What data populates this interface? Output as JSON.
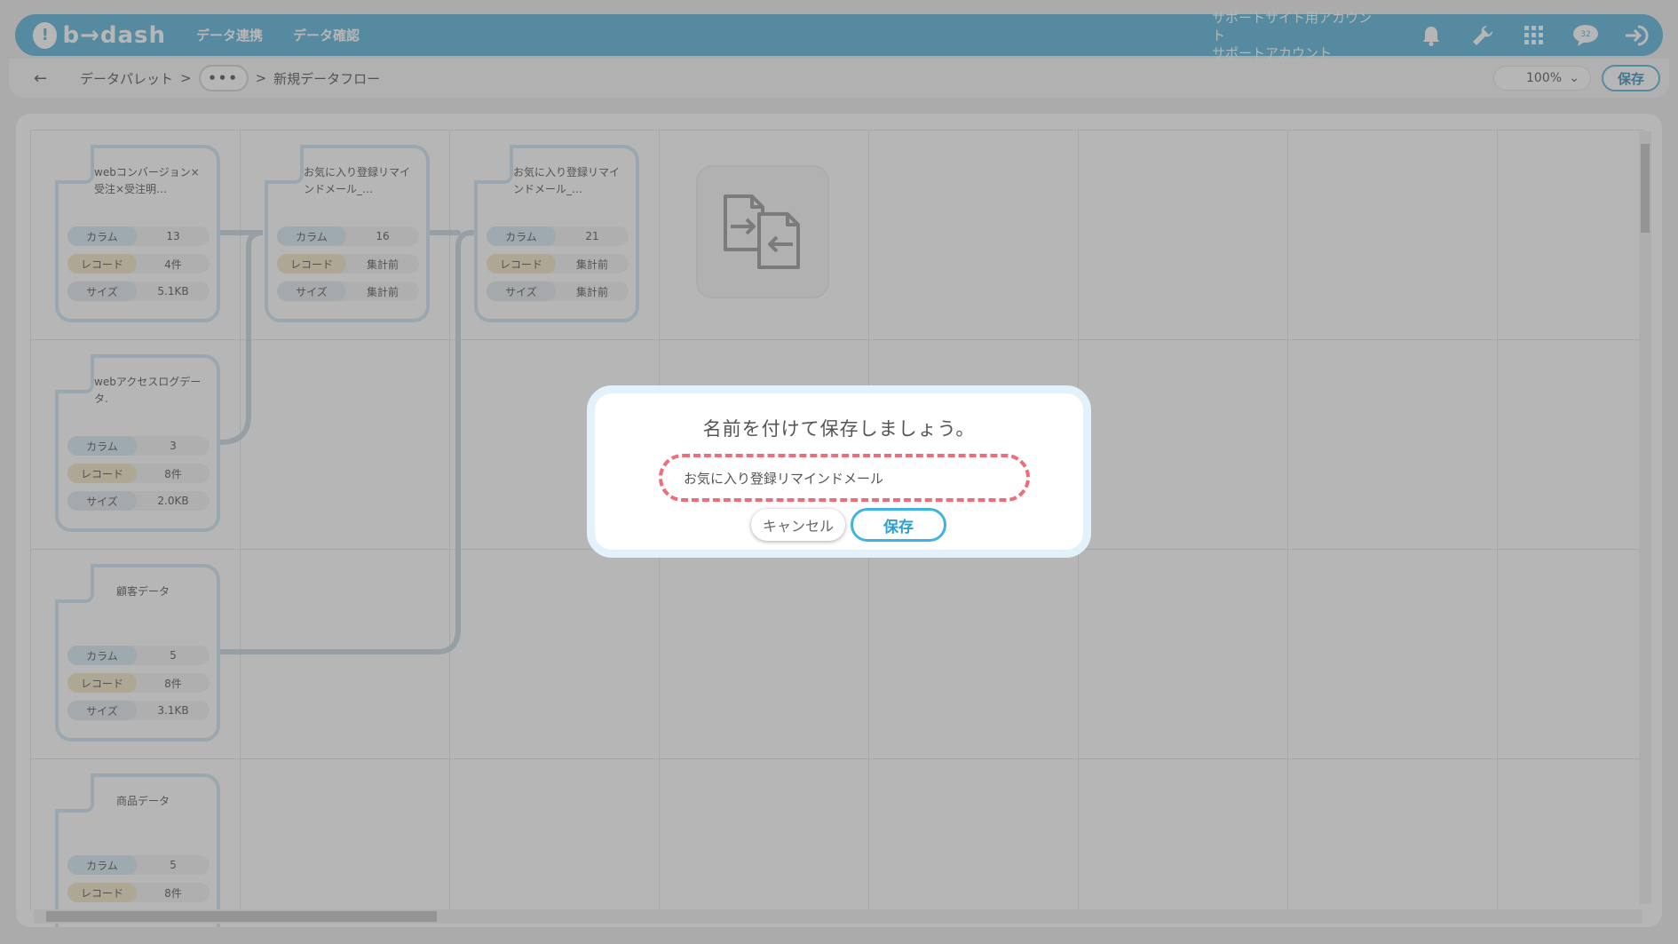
{
  "header": {
    "logo_text": "b→dash",
    "nav": [
      "データ連携",
      "データ確認"
    ],
    "account_line1": "サポートサイト用アカウント",
    "account_line2": "サポートアカウント",
    "icons": [
      "bell-icon",
      "wrench-icon",
      "grid-icon",
      "chat-icon",
      "logout-icon"
    ],
    "chat_badge": "32"
  },
  "breadcrumb": {
    "back": "←",
    "root": "データパレット",
    "separator": ">",
    "more": "•••",
    "current": "新規データフロー",
    "zoom": "100%",
    "save_label": "保存"
  },
  "nodes": [
    {
      "title": "webコンバージョン×受注×受注明…",
      "columns": "13",
      "records": "4件",
      "size": "5.1KB"
    },
    {
      "title": "お気に入り登録リマインドメール_…",
      "columns": "16",
      "records": "集計前",
      "size": "集計前"
    },
    {
      "title": "お気に入り登録リマインドメール_…",
      "columns": "21",
      "records": "集計前",
      "size": "集計前"
    },
    {
      "title": "webアクセスログデータ.",
      "columns": "3",
      "records": "8件",
      "size": "2.0KB"
    },
    {
      "title": "顧客データ",
      "columns": "5",
      "records": "8件",
      "size": "3.1KB"
    },
    {
      "title": "商品データ",
      "columns": "5",
      "records": "8件",
      "size": ""
    }
  ],
  "labels": {
    "columns": "カラム",
    "records": "レコード",
    "size": "サイズ"
  },
  "dialog": {
    "title": "名前を付けて保存しましょう。",
    "input_value": "お気に入り登録リマインドメール",
    "cancel_label": "キャンセル",
    "save_label": "保存"
  },
  "colors": {
    "header": "#5ab4da",
    "accent": "#3fb3df",
    "highlight": "#ef6d7b"
  }
}
